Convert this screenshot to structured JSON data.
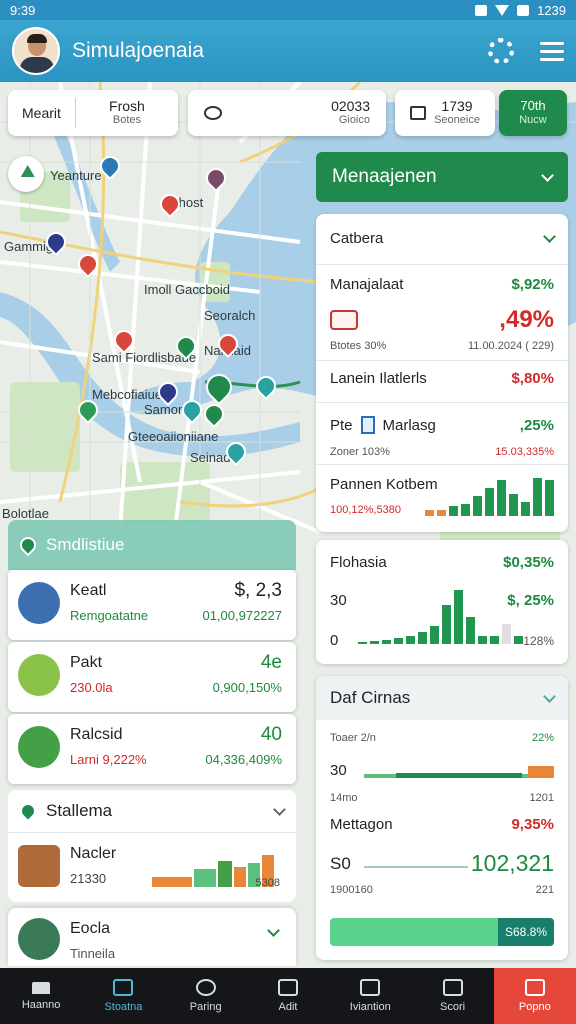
{
  "status_bar": {
    "time": "9:39",
    "clock": "1239"
  },
  "app": {
    "title": "Simulajoenaia"
  },
  "filters": {
    "chip1_left": "Mearit",
    "chip1_right": "Frosh",
    "chip1_sub": "Botes",
    "chip2_value": "02033",
    "chip2_sub": "Gioico",
    "chip3_value": "1739",
    "chip3_sub": "Seoneice",
    "chip4_value": "70th",
    "chip4_sub": "Nucw"
  },
  "map_labels": [
    "Yeanture",
    "Bhost",
    "Gammig",
    "Imoll Gaccboid",
    "Seoralch",
    "Sami Fiordlisbaue",
    "Naidlaid",
    "Mebcofiaiue",
    "Samon",
    "Gteeoaiioniiane",
    "Seinadd",
    "Bolotlae"
  ],
  "management": {
    "header": "Menaajenen",
    "section_title": "Catbera",
    "item1_name": "Manajalaat",
    "item1_value": "$,92%",
    "item1_change": ",49%",
    "item1_sub_left": "Btotes 30%",
    "item1_sub_right": "11.00.2024 ( 229)",
    "item2_name": "Lanein Ilatlerls",
    "item2_value": "$,80%",
    "item3_prefix": "Pte",
    "item3_name": "Marlasg",
    "item3_value": ",25%",
    "item3_sub_left": "Zoner 103%",
    "item3_sub_right": "15.03,335%",
    "item4_name": "Pannen Kotbem",
    "item4_sub": "100,12%,5380",
    "item4_bars": [
      6,
      6,
      10,
      12,
      20,
      28,
      36,
      22,
      14,
      38,
      36
    ],
    "chart_card": {
      "title": "Flohasia",
      "value1": "$0,35%",
      "label1": "30",
      "value2": "$, 25%",
      "label2": "0",
      "value3": "128%",
      "bars": [
        2,
        3,
        4,
        6,
        8,
        12,
        18,
        40,
        55,
        28,
        8,
        8,
        20,
        8
      ]
    },
    "details": {
      "title": "Daf Cirnas",
      "row1_label": "Toaer 2/n",
      "row1_value": "22%",
      "row2_label": "30",
      "row3_label": "14mo",
      "row3_value": "1201",
      "row4_label": "Mettagon",
      "row4_value": "9,35%",
      "row5_label": "S0",
      "row5_value": "102,321",
      "row6_label": "1900160",
      "row6_value": "221",
      "bar_label": "S68.8%"
    }
  },
  "left_panel": {
    "header": "Smdlistiue",
    "rows": [
      {
        "name": "Keatl",
        "sub": "Remgoatatne",
        "value": "$, 2,3",
        "value2": "01,00,972227"
      },
      {
        "name": "Pakt",
        "sub": "230.0la",
        "value": "4e",
        "value2": "0,900,150%"
      },
      {
        "name": "Ralcsid",
        "sub": "Larni 9,222%",
        "value": "40",
        "value2": "04,336,409%"
      }
    ],
    "stations_header": "Stallema",
    "station": {
      "name": "Nacler",
      "sub": "21330",
      "value": "5308"
    },
    "bottom": {
      "name": "Eocla",
      "sub": "Tinneila"
    }
  },
  "colors": {
    "primary": "#2b93c2",
    "green": "#1f8a4c",
    "red": "#d12a2a",
    "orange": "#e8873a"
  },
  "bottom_nav": [
    {
      "label": "Haanno",
      "icon": "home-icon"
    },
    {
      "label": "Stoatna",
      "icon": "map-icon"
    },
    {
      "label": "Paring",
      "icon": "power-icon"
    },
    {
      "label": "Adit",
      "icon": "building-icon"
    },
    {
      "label": "Iviantion",
      "icon": "book-icon"
    },
    {
      "label": "Scori",
      "icon": "document-icon"
    },
    {
      "label": "Popno",
      "icon": "alert-icon"
    }
  ]
}
